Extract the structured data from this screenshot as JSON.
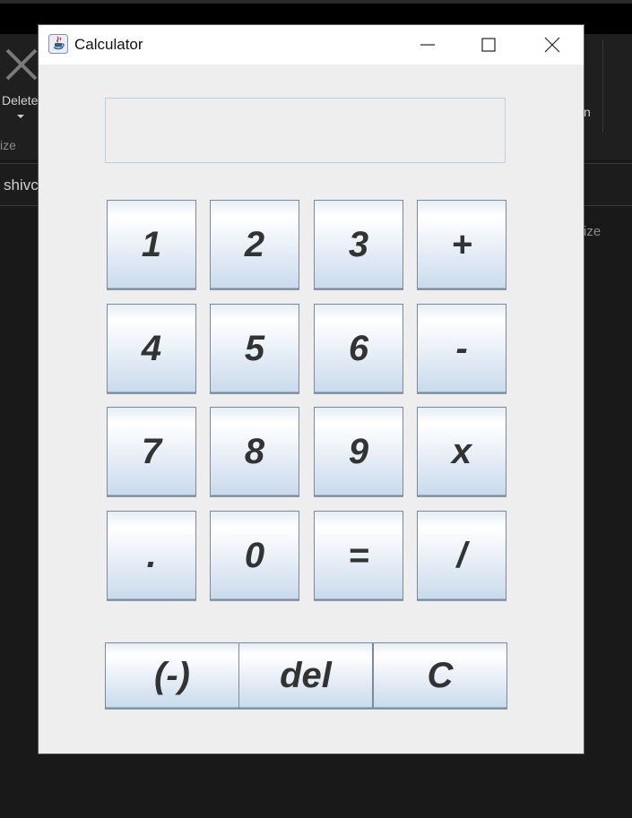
{
  "background_window": {
    "ribbon_delete_label": "Delete",
    "ribbon_group_label": "ize",
    "right_partial_label": "n",
    "address_text": "shivc",
    "column_header_partial": "ize"
  },
  "window": {
    "title": "Calculator"
  },
  "display": {
    "value": ""
  },
  "keypad": {
    "keys": [
      "1",
      "2",
      "3",
      "+",
      "4",
      "5",
      "6",
      "-",
      "7",
      "8",
      "9",
      "x",
      ".",
      "0",
      "=",
      "/"
    ]
  },
  "bottom_keys": {
    "negate": "(-)",
    "delete": "del",
    "clear": "C"
  }
}
